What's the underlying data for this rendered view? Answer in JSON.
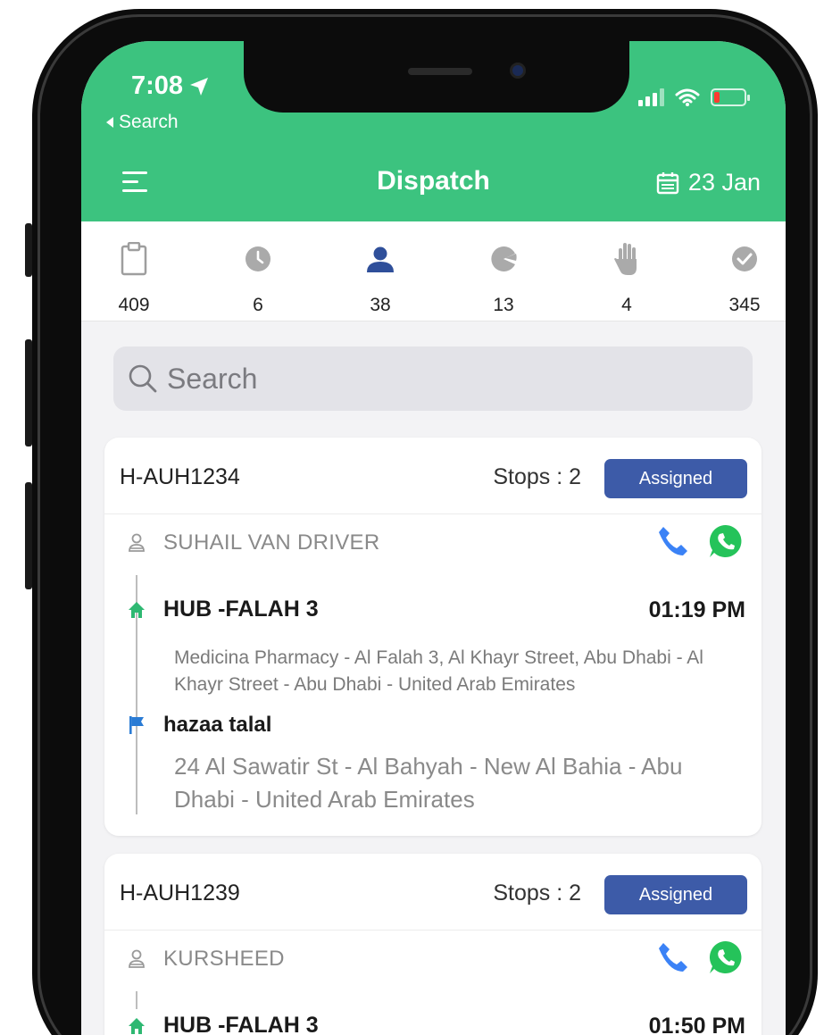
{
  "status_bar": {
    "time": "7:08",
    "back_label": "Search"
  },
  "header": {
    "title": "Dispatch",
    "date": "23 Jan"
  },
  "stats": [
    {
      "icon": "clipboard-icon",
      "count": "409"
    },
    {
      "icon": "clock-icon",
      "count": "6"
    },
    {
      "icon": "person-icon",
      "count": "38"
    },
    {
      "icon": "pie-chart-icon",
      "count": "13"
    },
    {
      "icon": "hand-icon",
      "count": "4"
    },
    {
      "icon": "check-circle-icon",
      "count": "345"
    }
  ],
  "search": {
    "placeholder": "Search"
  },
  "orders": [
    {
      "id": "H-AUH1234",
      "stops": "Stops : 2",
      "status": "Assigned",
      "driver": "SUHAIL VAN DRIVER",
      "pickup_name": "HUB -FALAH 3",
      "pickup_time": "01:19 PM",
      "pickup_address": "Medicina Pharmacy - Al Falah 3, Al Khayr Street, Abu Dhabi - Al Khayr Street - Abu Dhabi - United Arab Emirates",
      "drop_name": "hazaa talal",
      "drop_address": "24 Al Sawatir St - Al Bahyah - New Al Bahia - Abu Dhabi - United Arab Emirates"
    },
    {
      "id": "H-AUH1239",
      "stops": "Stops : 2",
      "status": "Assigned",
      "driver": "KURSHEED",
      "pickup_name": "HUB -FALAH 3",
      "pickup_time": "01:50 PM"
    }
  ],
  "colors": {
    "brand_green": "#3cc37f",
    "badge_blue": "#3d5ba8",
    "call_blue": "#3b82f6",
    "whatsapp_green": "#25c35a"
  }
}
